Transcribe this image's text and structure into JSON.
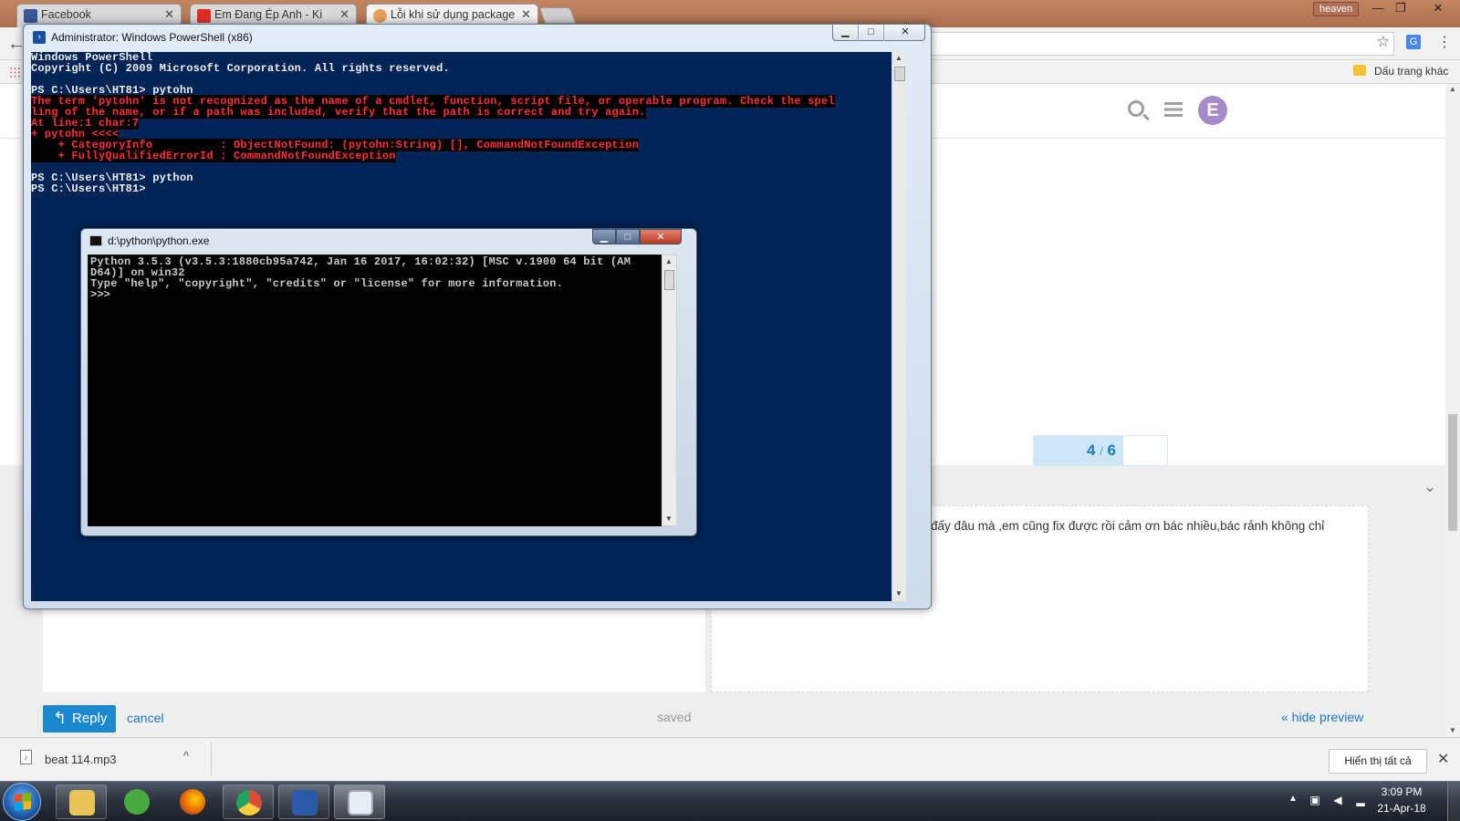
{
  "browser": {
    "tabs": [
      {
        "label": "Facebook",
        "favicon_color": "#3b5998",
        "active": false
      },
      {
        "label": "Em Đang Ép Anh - Ki",
        "favicon_color": "#e52d27",
        "active": false
      },
      {
        "label": "Lỗi khi sử dụng package",
        "favicon_color": "#e8a05c",
        "active": true
      }
    ],
    "profile_name": "heaven",
    "bookmark_other": "Dấu trang khác",
    "window_controls": {
      "minimize": "—",
      "restore": "❐",
      "close": "✕"
    }
  },
  "page": {
    "avatar_letter": "E",
    "progress": {
      "current": "4",
      "total": "6",
      "fraction": 0.67
    },
    "preview_text": "đấy đâu mà ,em cũng fix được rồi cảm ơn bác nhiều,bác rảnh không chỉ",
    "reply_label": "Reply",
    "cancel_label": "cancel",
    "saved_label": "saved",
    "hide_preview_label": "« hide preview"
  },
  "downloads": {
    "filename": "beat 114.mp3",
    "show_all_label": "Hiển thị tất cả"
  },
  "powershell": {
    "title": "Administrator: Windows PowerShell (x86)",
    "lines": [
      {
        "text": "Windows PowerShell",
        "type": "normal"
      },
      {
        "text": "Copyright (C) 2009 Microsoft Corporation. All rights reserved.",
        "type": "normal"
      },
      {
        "text": "",
        "type": "normal"
      },
      {
        "text": "PS C:\\Users\\HT81> pytohn",
        "type": "normal"
      },
      {
        "text": "The term 'pytohn' is not recognized as the name of a cmdlet, function, script file, or operable program. Check the spel",
        "type": "error"
      },
      {
        "text": "ling of the name, or if a path was included, verify that the path is correct and try again.",
        "type": "error"
      },
      {
        "text": "At line:1 char:7",
        "type": "error"
      },
      {
        "text": "+ pytohn <<<<",
        "type": "error"
      },
      {
        "text": "    + CategoryInfo          : ObjectNotFound: (pytohn:String) [], CommandNotFoundException",
        "type": "error"
      },
      {
        "text": "    + FullyQualifiedErrorId : CommandNotFoundException",
        "type": "error"
      },
      {
        "text": "",
        "type": "normal"
      },
      {
        "text": "PS C:\\Users\\HT81> python",
        "type": "normal"
      },
      {
        "text": "PS C:\\Users\\HT81>",
        "type": "normal"
      }
    ]
  },
  "python_console": {
    "title": "d:\\python\\python.exe",
    "lines": [
      "Python 3.5.3 (v3.5.3:1880cb95a742, Jan 16 2017, 16:02:32) [MSC v.1900 64 bit (AM",
      "D64)] on win32",
      "Type \"help\", \"copyright\", \"credits\" or \"license\" for more information.",
      ">>>"
    ]
  },
  "taskbar": {
    "apps": [
      {
        "name": "explorer",
        "color": "#e8c35a"
      },
      {
        "name": "greenshot",
        "color": "#49a941"
      },
      {
        "name": "firefox",
        "color": "#e66000"
      },
      {
        "name": "chrome",
        "color": "#dd4b39"
      },
      {
        "name": "powershell",
        "color": "#2b5aa8"
      },
      {
        "name": "python-console",
        "color": "#9aa7b5"
      }
    ],
    "time": "3:09 PM",
    "date": "21-Apr-18"
  }
}
